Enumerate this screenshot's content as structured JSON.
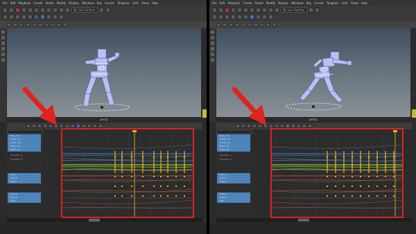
{
  "menu": {
    "items": [
      "File",
      "Edit",
      "Playback",
      "Create",
      "Select",
      "Modify",
      "Display",
      "Windows",
      "Key",
      "Curves",
      "Tangents",
      "Lists",
      "Show",
      "Help"
    ]
  },
  "toolbar": {
    "field_text": "No Live Surface"
  },
  "viewport": {
    "caption": "persp"
  },
  "outliner": {
    "rows_left": [
      "Hips_ctrl",
      "Spine_ctrl",
      "Chest_ctrl",
      "Neck_ctrl",
      "Head_ctrl",
      "Shoulder_L",
      "Shoulder_R",
      "",
      "",
      "",
      "Arm_L",
      "Arm_R",
      "Leg_L",
      "",
      "Foot_L",
      "Foot_R",
      "Root"
    ],
    "rows_right": [
      "Hips_ctrl",
      "Spine_ctrl",
      "Chest_ctrl",
      "Neck_ctrl",
      "Head_ctrl",
      "Shoulder_L",
      "Shoulder_R",
      "",
      "",
      "",
      "Arm_L",
      "Arm_R",
      "Leg_L",
      "",
      "Foot_L",
      "Foot_R",
      "Root"
    ]
  },
  "colors": {
    "highlight": "#e0231f",
    "selection": "#4d84bb",
    "keyframe": "#f2b21c",
    "curve_blue": "#3b7ec9",
    "curve_green": "#8abf3b",
    "curve_red": "#c84a3a",
    "rig": "#b9c0f4"
  }
}
